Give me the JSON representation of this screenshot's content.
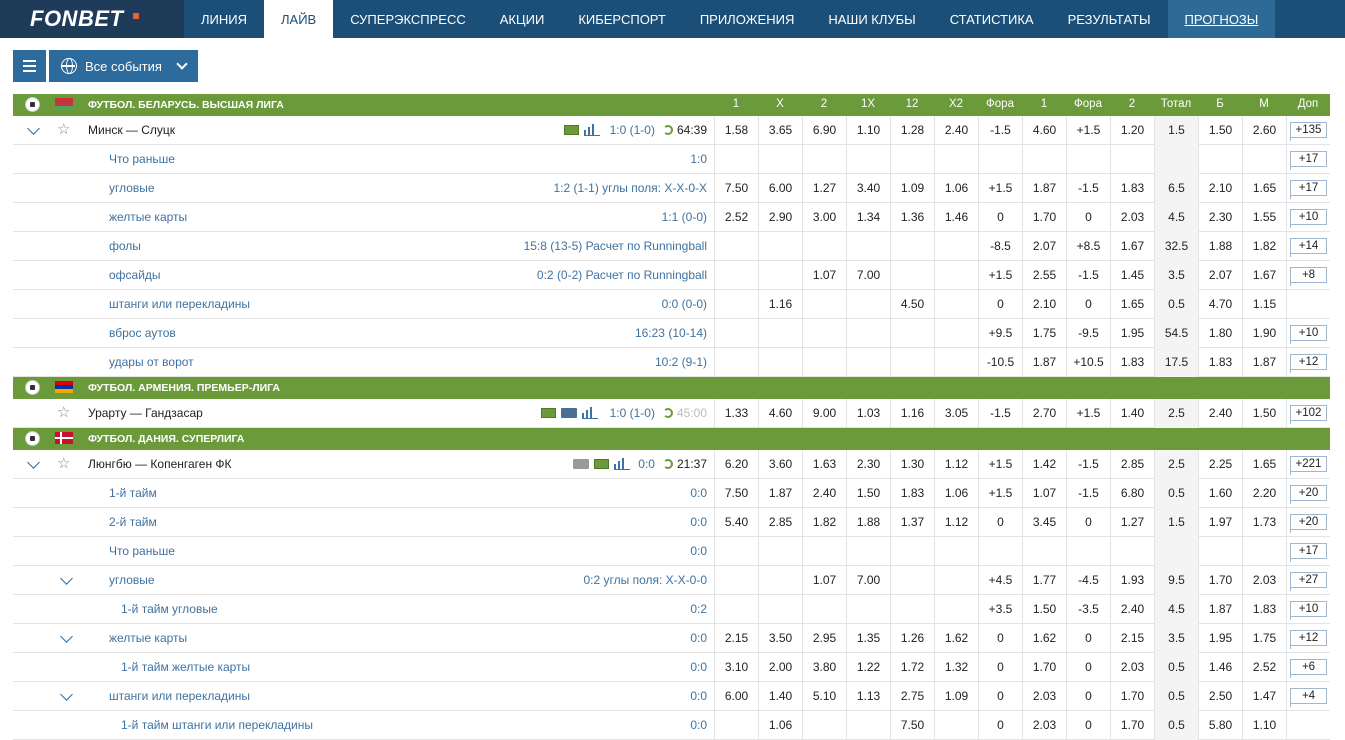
{
  "brand": {
    "name": "FONBET"
  },
  "nav": [
    "ЛИНИЯ",
    "ЛАЙВ",
    "СУПЕРЭКСПРЕСС",
    "АКЦИИ",
    "КИБЕРСПОРТ",
    "ПРИЛОЖЕНИЯ",
    "НАШИ КЛУБЫ",
    "СТАТИСТИКА",
    "РЕЗУЛЬТАТЫ",
    "ПРОГНОЗЫ"
  ],
  "toolbar": {
    "events_label": "Все события"
  },
  "columns": [
    "1",
    "X",
    "2",
    "1X",
    "12",
    "X2",
    "Фора",
    "1",
    "Фора",
    "2",
    "Тотал",
    "Б",
    "М",
    "Доп"
  ],
  "rows": [
    {
      "type": "league",
      "name": "ФУТБОЛ. БЕЛАРУСЬ. ВЫСШАЯ ЛИГА",
      "flag": "belarus",
      "header": true
    },
    {
      "type": "match",
      "name": "Минск — Слуцк",
      "expanded": true,
      "score": "1:0 (1-0)",
      "time": "64:39",
      "icons": [
        "field",
        "stats"
      ],
      "odds": [
        "1.58",
        "3.65",
        "6.90",
        "1.10",
        "1.28",
        "2.40",
        "-1.5",
        "4.60",
        "+1.5",
        "1.20",
        "1.5",
        "1.50",
        "2.60"
      ],
      "more": "+135"
    },
    {
      "type": "sub",
      "name": "Что раньше",
      "score": "1:0",
      "odds": [
        "",
        "",
        "",
        "",
        "",
        "",
        "",
        "",
        "",
        "",
        "",
        "",
        ""
      ],
      "more": "+17"
    },
    {
      "type": "sub",
      "name": "угловые",
      "score": "1:2  (1-1) углы поля: X-X-0-X",
      "odds": [
        "7.50",
        "6.00",
        "1.27",
        "3.40",
        "1.09",
        "1.06",
        "+1.5",
        "1.87",
        "-1.5",
        "1.83",
        "6.5",
        "2.10",
        "1.65"
      ],
      "more": "+17"
    },
    {
      "type": "sub",
      "name": "желтые карты",
      "score": "1:1  (0-0)",
      "odds": [
        "2.52",
        "2.90",
        "3.00",
        "1.34",
        "1.36",
        "1.46",
        "0",
        "1.70",
        "0",
        "2.03",
        "4.5",
        "2.30",
        "1.55"
      ],
      "more": "+10"
    },
    {
      "type": "sub",
      "name": "фолы",
      "score": "15:8  (13-5) Расчет по Runningball",
      "odds": [
        "",
        "",
        "",
        "",
        "",
        "",
        "-8.5",
        "2.07",
        "+8.5",
        "1.67",
        "32.5",
        "1.88",
        "1.82"
      ],
      "more": "+14"
    },
    {
      "type": "sub",
      "name": "офсайды",
      "score": "0:2  (0-2) Расчет по Runningball",
      "odds": [
        "",
        "",
        "1.07",
        "7.00",
        "",
        "",
        "+1.5",
        "2.55",
        "-1.5",
        "1.45",
        "3.5",
        "2.07",
        "1.67"
      ],
      "more": "+8"
    },
    {
      "type": "sub",
      "name": "штанги или перекладины",
      "score": "0:0  (0-0)",
      "odds": [
        "",
        "1.16",
        "",
        "",
        "4.50",
        "",
        "0",
        "2.10",
        "0",
        "1.65",
        "0.5",
        "4.70",
        "1.15"
      ],
      "more": ""
    },
    {
      "type": "sub",
      "name": "вброс аутов",
      "score": "16:23  (10-14)",
      "odds": [
        "",
        "",
        "",
        "",
        "",
        "",
        "+9.5",
        "1.75",
        "-9.5",
        "1.95",
        "54.5",
        "1.80",
        "1.90"
      ],
      "more": "+10"
    },
    {
      "type": "sub",
      "name": "удары от ворот",
      "score": "10:2  (9-1)",
      "odds": [
        "",
        "",
        "",
        "",
        "",
        "",
        "-10.5",
        "1.87",
        "+10.5",
        "1.83",
        "17.5",
        "1.83",
        "1.87"
      ],
      "more": "+12"
    },
    {
      "type": "league",
      "name": "ФУТБОЛ. АРМЕНИЯ. ПРЕМЬЕР-ЛИГА",
      "flag": "armenia"
    },
    {
      "type": "match",
      "name": "Урарту — Гандзасар",
      "expanded": false,
      "score": "1:0 (1-0)",
      "time": "45:00",
      "time_gray": true,
      "icons": [
        "field",
        "tv",
        "stats"
      ],
      "odds": [
        "1.33",
        "4.60",
        "9.00",
        "1.03",
        "1.16",
        "3.05",
        "-1.5",
        "2.70",
        "+1.5",
        "1.40",
        "2.5",
        "2.40",
        "1.50"
      ],
      "more": "+102"
    },
    {
      "type": "league",
      "name": "ФУТБОЛ. ДАНИЯ. СУПЕРЛИГА",
      "flag": "denmark"
    },
    {
      "type": "match",
      "name": "Люнгбю — Копенгаген ФК",
      "expanded": true,
      "score": "0:0",
      "time": "21:37",
      "icons": [
        "tvgray",
        "field",
        "stats"
      ],
      "odds": [
        "6.20",
        "3.60",
        "1.63",
        "2.30",
        "1.30",
        "1.12",
        "+1.5",
        "1.42",
        "-1.5",
        "2.85",
        "2.5",
        "2.25",
        "1.65"
      ],
      "more": "+221"
    },
    {
      "type": "sub",
      "name": "1-й тайм",
      "score": "0:0",
      "odds": [
        "7.50",
        "1.87",
        "2.40",
        "1.50",
        "1.83",
        "1.06",
        "+1.5",
        "1.07",
        "-1.5",
        "6.80",
        "0.5",
        "1.60",
        "2.20"
      ],
      "more": "+20"
    },
    {
      "type": "sub",
      "name": "2-й тайм",
      "score": "0:0",
      "odds": [
        "5.40",
        "2.85",
        "1.82",
        "1.88",
        "1.37",
        "1.12",
        "0",
        "3.45",
        "0",
        "1.27",
        "1.5",
        "1.97",
        "1.73"
      ],
      "more": "+20"
    },
    {
      "type": "sub",
      "name": "Что раньше",
      "score": "0:0",
      "odds": [
        "",
        "",
        "",
        "",
        "",
        "",
        "",
        "",
        "",
        "",
        "",
        "",
        ""
      ],
      "more": "+17"
    },
    {
      "type": "sub",
      "name": "угловые",
      "expandable": true,
      "score": "0:2  углы поля: X-X-0-0",
      "odds": [
        "",
        "",
        "1.07",
        "7.00",
        "",
        "",
        "+4.5",
        "1.77",
        "-4.5",
        "1.93",
        "9.5",
        "1.70",
        "2.03"
      ],
      "more": "+27"
    },
    {
      "type": "sub2",
      "name": "1-й тайм угловые",
      "score": "0:2",
      "odds": [
        "",
        "",
        "",
        "",
        "",
        "",
        "+3.5",
        "1.50",
        "-3.5",
        "2.40",
        "4.5",
        "1.87",
        "1.83"
      ],
      "more": "+10"
    },
    {
      "type": "sub",
      "name": "желтые карты",
      "expandable": true,
      "score": "0:0",
      "odds": [
        "2.15",
        "3.50",
        "2.95",
        "1.35",
        "1.26",
        "1.62",
        "0",
        "1.62",
        "0",
        "2.15",
        "3.5",
        "1.95",
        "1.75"
      ],
      "more": "+12"
    },
    {
      "type": "sub2",
      "name": "1-й тайм желтые карты",
      "score": "0:0",
      "odds": [
        "3.10",
        "2.00",
        "3.80",
        "1.22",
        "1.72",
        "1.32",
        "0",
        "1.70",
        "0",
        "2.03",
        "0.5",
        "1.46",
        "2.52"
      ],
      "more": "+6"
    },
    {
      "type": "sub",
      "name": "штанги или перекладины",
      "expandable": true,
      "score": "0:0",
      "odds": [
        "6.00",
        "1.40",
        "5.10",
        "1.13",
        "2.75",
        "1.09",
        "0",
        "2.03",
        "0",
        "1.70",
        "0.5",
        "2.50",
        "1.47"
      ],
      "more": "+4"
    },
    {
      "type": "sub2",
      "name": "1-й тайм штанги или перекладины",
      "score": "0:0",
      "odds": [
        "",
        "1.06",
        "",
        "",
        "7.50",
        "",
        "0",
        "2.03",
        "0",
        "1.70",
        "0.5",
        "5.80",
        "1.10"
      ],
      "more": ""
    }
  ]
}
